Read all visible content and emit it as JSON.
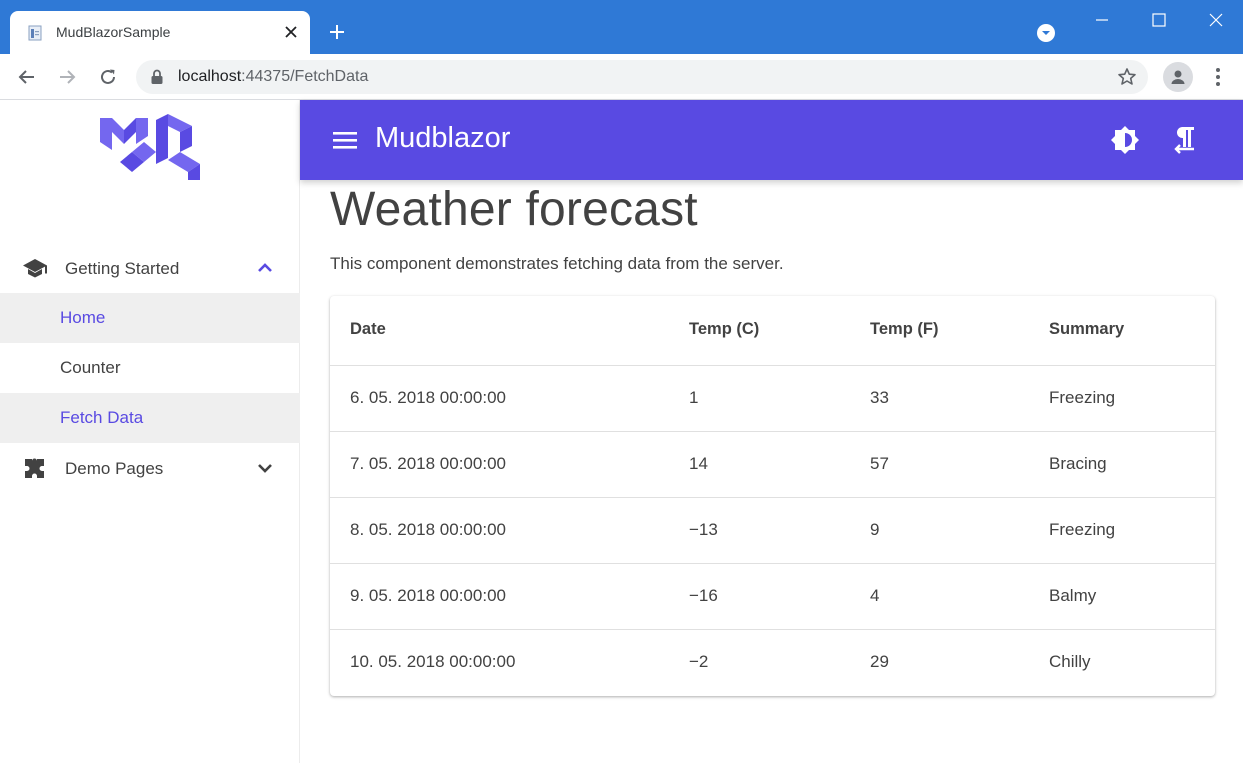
{
  "browser": {
    "tab_title": "MudBlazorSample",
    "url_host": "localhost",
    "url_path": ":44375/FetchData"
  },
  "drawer": {
    "groups": [
      {
        "label": "Getting Started",
        "icon": "school-icon",
        "expanded": true
      },
      {
        "label": "Demo Pages",
        "icon": "extension-icon",
        "expanded": false
      }
    ],
    "links": [
      {
        "label": "Home",
        "active": true
      },
      {
        "label": "Counter",
        "active": false
      },
      {
        "label": "Fetch Data",
        "active": true
      }
    ]
  },
  "appbar": {
    "title": "Mudblazor",
    "color": "#594ae2"
  },
  "page": {
    "title": "Weather forecast",
    "description": "This component demonstrates fetching data from the server."
  },
  "table": {
    "headers": [
      "Date",
      "Temp (C)",
      "Temp (F)",
      "Summary"
    ],
    "rows": [
      [
        "6. 05. 2018 00:00:00",
        "1",
        "33",
        "Freezing"
      ],
      [
        "7. 05. 2018 00:00:00",
        "14",
        "57",
        "Bracing"
      ],
      [
        "8. 05. 2018 00:00:00",
        "−13",
        "9",
        "Freezing"
      ],
      [
        "9. 05. 2018 00:00:00",
        "−16",
        "4",
        "Balmy"
      ],
      [
        "10. 05. 2018 00:00:00",
        "−2",
        "29",
        "Chilly"
      ]
    ]
  }
}
